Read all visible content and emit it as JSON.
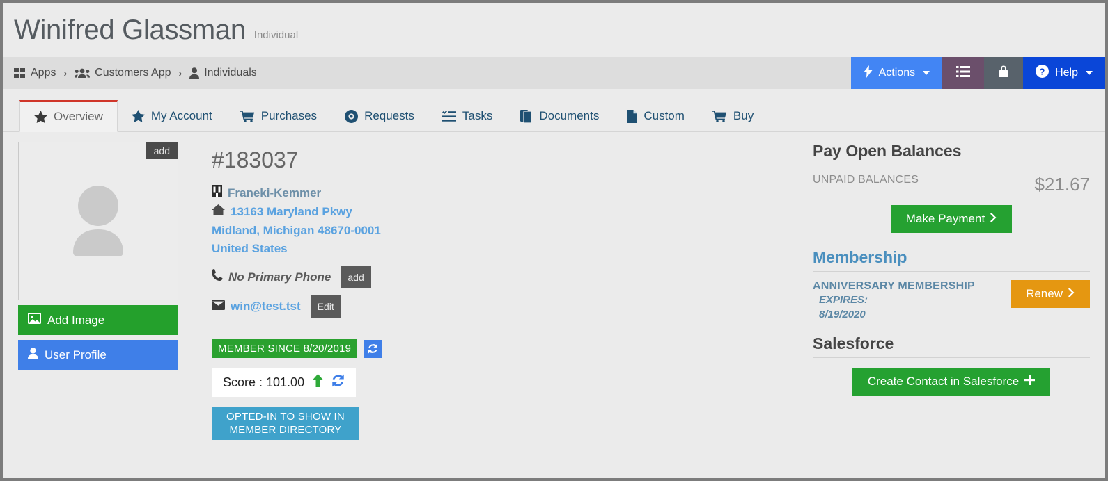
{
  "header": {
    "title": "Winifred Glassman",
    "subtitle": "Individual"
  },
  "breadcrumb": {
    "items": [
      {
        "label": "Apps",
        "icon": "grid-icon"
      },
      {
        "label": "Customers App",
        "icon": "users-icon"
      },
      {
        "label": "Individuals",
        "icon": "person-icon"
      }
    ],
    "separator": "›",
    "buttons": {
      "actions": "Actions",
      "help": "Help",
      "list_icon": "list-icon",
      "lock_icon": "lock-icon"
    }
  },
  "tabs": [
    {
      "label": "Overview",
      "icon": "star-icon",
      "active": true
    },
    {
      "label": "My Account",
      "icon": "star-icon",
      "active": false
    },
    {
      "label": "Purchases",
      "icon": "cart-icon",
      "active": false
    },
    {
      "label": "Requests",
      "icon": "lifering-icon",
      "active": false
    },
    {
      "label": "Tasks",
      "icon": "tasks-icon",
      "active": false
    },
    {
      "label": "Documents",
      "icon": "documents-icon",
      "active": false
    },
    {
      "label": "Custom",
      "icon": "file-icon",
      "active": false
    },
    {
      "label": "Buy",
      "icon": "cart-icon",
      "active": false
    }
  ],
  "photo": {
    "add_chip": "add",
    "add_image_button": "Add Image",
    "user_profile_button": "User Profile"
  },
  "record": {
    "id": "#183037",
    "organization": "Franeki-Kemmer",
    "address_line1": "13163 Maryland Pkwy",
    "address_line2": "Midland, Michigan 48670-0001",
    "address_line3": "United States",
    "phone_text": "No Primary Phone",
    "phone_action": "add",
    "email": "win@test.tst",
    "email_action": "Edit",
    "member_since_badge": "MEMBER SINCE 8/20/2019",
    "score_label": "Score : 101.00",
    "directory_badge": "OPTED-IN TO SHOW IN MEMBER DIRECTORY"
  },
  "rail": {
    "pay_open_balances": {
      "heading": "Pay Open Balances",
      "label": "UNPAID BALANCES",
      "amount": "$21.67",
      "button": "Make Payment"
    },
    "membership": {
      "heading": "Membership",
      "name": "ANNIVERSARY MEMBERSHIP",
      "expires_label": "EXPIRES:",
      "expires_date": "8/19/2020",
      "button": "Renew"
    },
    "salesforce": {
      "heading": "Salesforce",
      "button": "Create Contact in Salesforce"
    }
  },
  "colors": {
    "accent_blue": "#4285f4",
    "help_blue": "#0a46d8",
    "green": "#25a131",
    "orange": "#e59711",
    "cyan": "#3fa2cb",
    "active_tab_red": "#d0362a",
    "link_blue": "#5aa2e0"
  }
}
